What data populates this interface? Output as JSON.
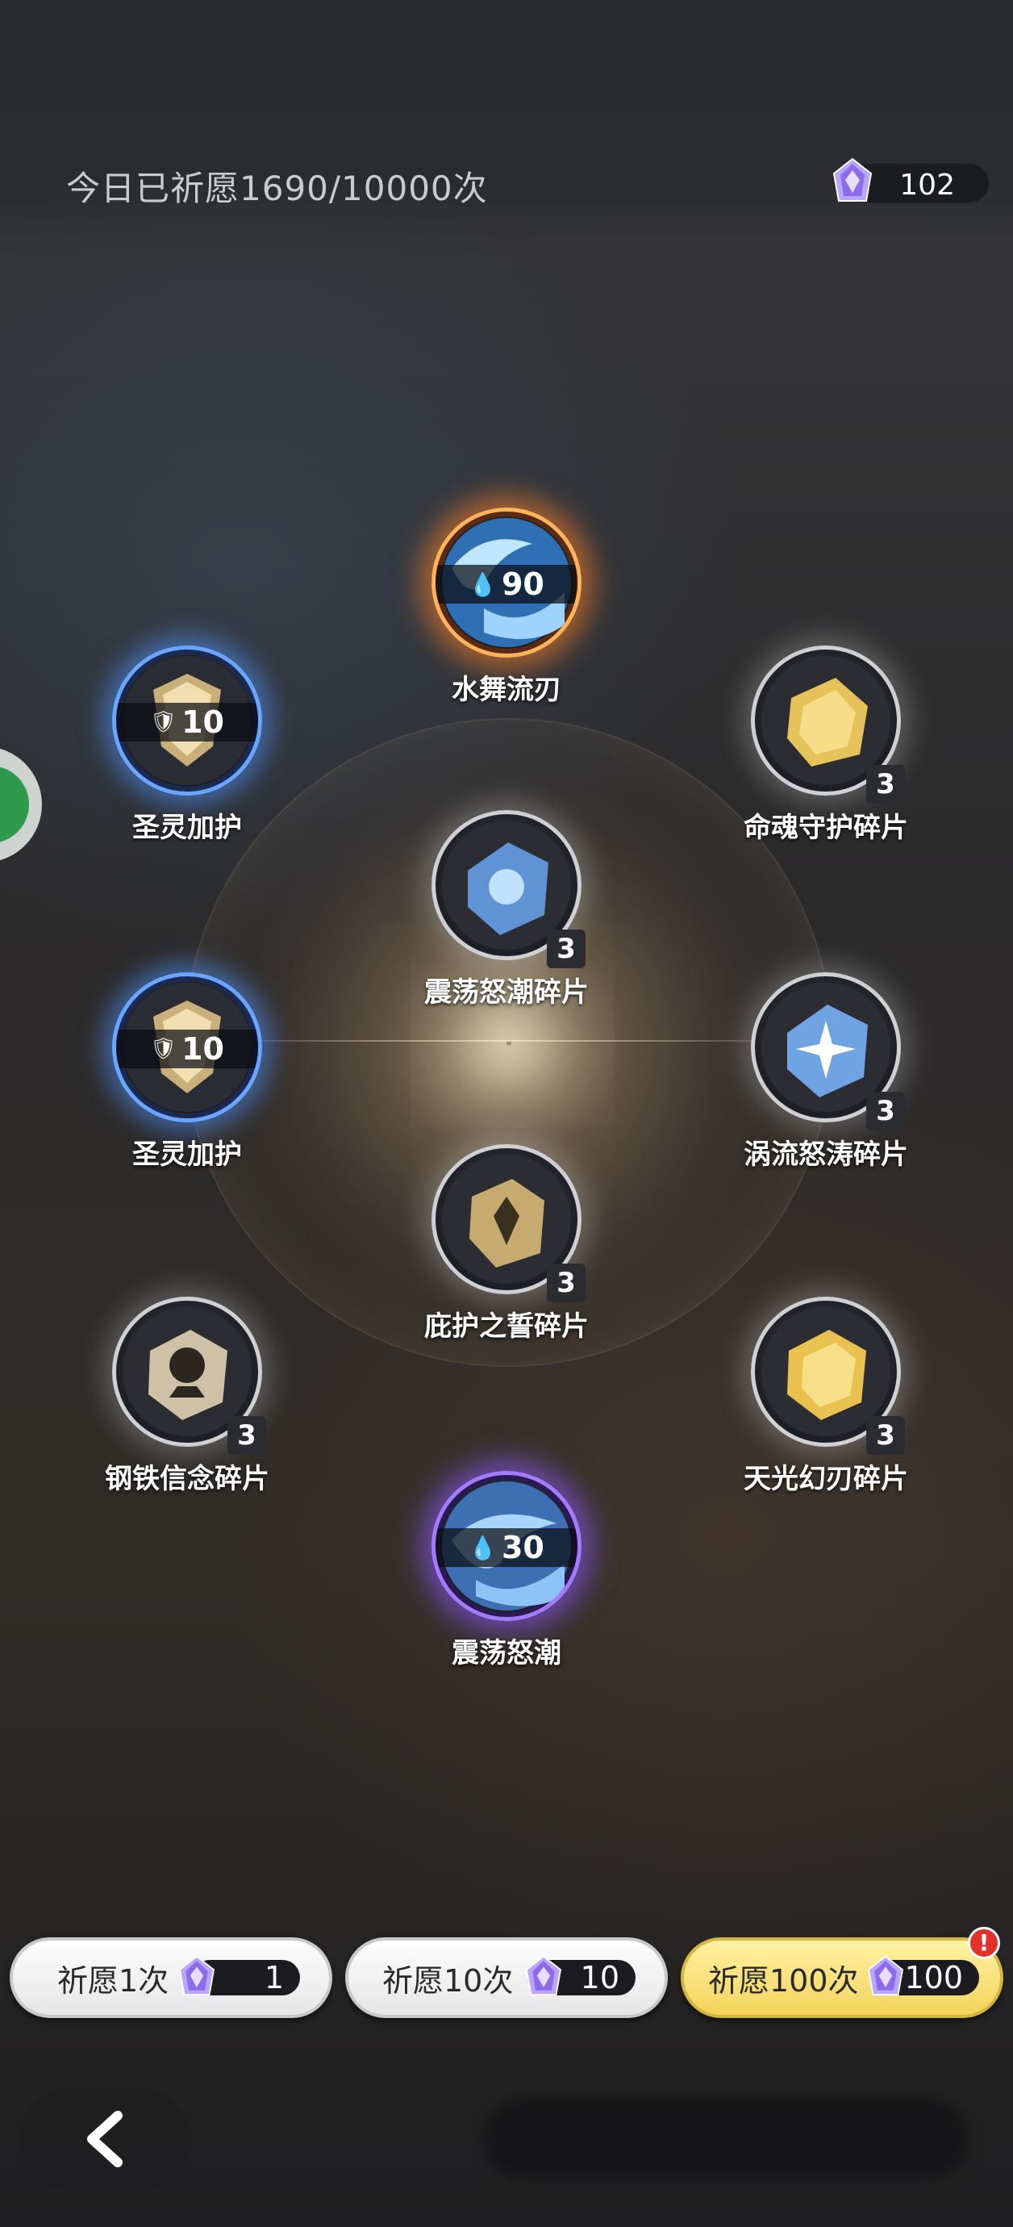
{
  "header": {
    "wish_count_text": "今日已祈愿1690/10000次",
    "currency_value": "102",
    "currency_icon": "crystal-icon"
  },
  "rewards": [
    {
      "id": "shui-wu-liu-ren",
      "label": "水舞流刃",
      "band_value": "90",
      "frame": "orange"
    },
    {
      "id": "sheng-ling-jia-hu-1",
      "label": "圣灵加护",
      "band_value": "10",
      "frame": "blue"
    },
    {
      "id": "ming-hun-shou-hu",
      "label": "命魂守护碎片",
      "qty": "3",
      "frame": "white"
    },
    {
      "id": "zhen-dang-nu-chao-sui",
      "label": "震荡怒潮碎片",
      "qty": "3",
      "frame": "white"
    },
    {
      "id": "sheng-ling-jia-hu-2",
      "label": "圣灵加护",
      "band_value": "10",
      "frame": "blue"
    },
    {
      "id": "wo-liu-nu-tao",
      "label": "涡流怒涛碎片",
      "qty": "3",
      "frame": "white"
    },
    {
      "id": "bi-hu-zhi-shi",
      "label": "庇护之誓碎片",
      "qty": "3",
      "frame": "white"
    },
    {
      "id": "gang-tie-xin-nian",
      "label": "钢铁信念碎片",
      "qty": "3",
      "frame": "white"
    },
    {
      "id": "tian-guang-huan-ren",
      "label": "天光幻刃碎片",
      "qty": "3",
      "frame": "white"
    },
    {
      "id": "zhen-dang-nu-chao",
      "label": "震荡怒潮",
      "band_value": "30",
      "frame": "purple"
    }
  ],
  "actions": {
    "wish_1": {
      "label": "祈愿1次",
      "cost": "1"
    },
    "wish_10": {
      "label": "祈愿10次",
      "cost": "10"
    },
    "wish_100": {
      "label": "祈愿100次",
      "cost": "100",
      "alert": "!"
    }
  },
  "colors": {
    "orange_frame": "#ffb35a",
    "blue_frame": "#6aa6ff",
    "purple_frame": "#a47bff",
    "gold_button": "#f3d35a"
  }
}
